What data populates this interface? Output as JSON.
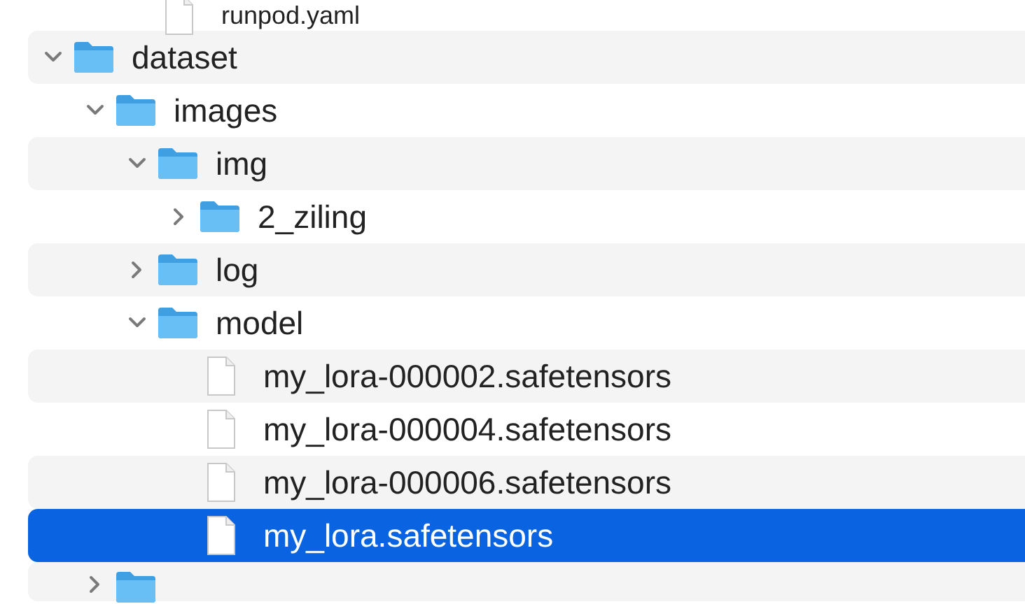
{
  "partial_item": {
    "name": "runpod.yaml",
    "kind": "file",
    "selected": false
  },
  "items": [
    {
      "name": "dataset",
      "kind": "folder",
      "expanded": true,
      "selected": false,
      "children": [
        {
          "name": "images",
          "kind": "folder",
          "expanded": true,
          "selected": false,
          "children": [
            {
              "name": "img",
              "kind": "folder",
              "expanded": true,
              "selected": false,
              "children": [
                {
                  "name": "2_ziling",
                  "kind": "folder",
                  "expanded": false,
                  "selected": false
                }
              ]
            },
            {
              "name": "log",
              "kind": "folder",
              "expanded": false,
              "selected": false
            },
            {
              "name": "model",
              "kind": "folder",
              "expanded": true,
              "selected": false,
              "children": [
                {
                  "name": "my_lora-000002.safetensors",
                  "kind": "file",
                  "selected": false
                },
                {
                  "name": "my_lora-000004.safetensors",
                  "kind": "file",
                  "selected": false
                },
                {
                  "name": "my_lora-000006.safetensors",
                  "kind": "file",
                  "selected": false
                },
                {
                  "name": "my_lora.safetensors",
                  "kind": "file",
                  "selected": true
                }
              ]
            }
          ]
        },
        {
          "kind": "folder",
          "expanded": false,
          "selected": false
        }
      ]
    }
  ]
}
